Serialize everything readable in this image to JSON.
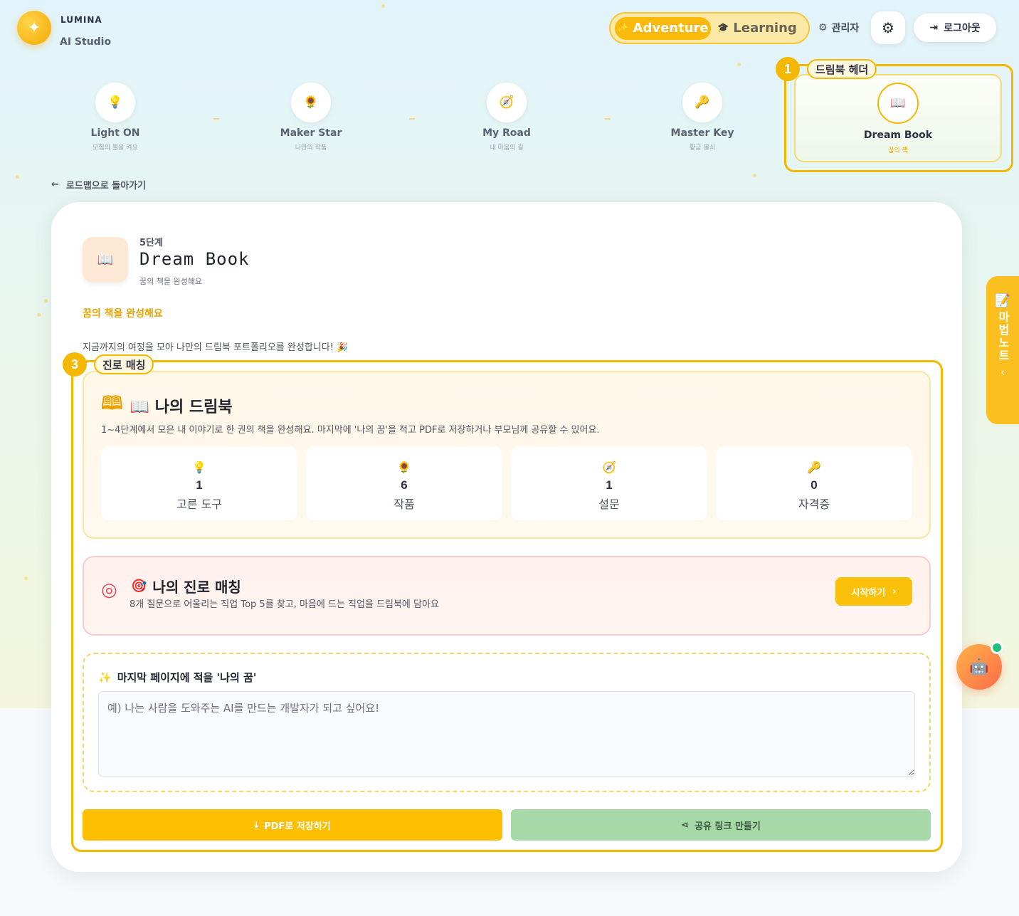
{
  "app": {
    "brand": "LUMINA",
    "brand_sub": "AI Studio"
  },
  "header": {
    "modes": [
      {
        "label": "Adventure",
        "active": true
      },
      {
        "label": "Learning",
        "active": false
      }
    ],
    "admin_label": "관리자",
    "logout_label": "로그아웃"
  },
  "roadmap": {
    "stages": [
      {
        "name": "Light ON",
        "sub": "모험의 불을 켜요",
        "icon": "lightbulb-icon"
      },
      {
        "name": "Maker Star",
        "sub": "나만의 작품",
        "icon": "sunflower-icon"
      },
      {
        "name": "My Road",
        "sub": "내 마음의 길",
        "icon": "compass-icon"
      },
      {
        "name": "Master Key",
        "sub": "황금 열쇠",
        "icon": "key-icon"
      },
      {
        "name": "Dream Book",
        "sub": "꿈의 책",
        "icon": "book-icon",
        "active": true
      }
    ]
  },
  "annotations": [
    {
      "num": "1",
      "label": "드림북 헤더"
    },
    {
      "num": "3",
      "label": "진로 매칭"
    }
  ],
  "back_label": "로드맵으로 돌아가기",
  "stage_header": {
    "step": "5단계",
    "title": "Dream Book",
    "subtitle": "꿈의 책을 완성해요",
    "highlight": "꿈의 책을 완성해요",
    "intro": "지금까지의 여정을 모아 나만의 드림북 포트폴리오를 완성합니다! 🎉"
  },
  "dreambook": {
    "title": "📖 나의 드림북",
    "desc": "1~4단계에서 모은 내 이야기로 한 권의 책을 완성해요. 마지막에 '나의 꿈'을 적고 PDF로 저장하거나 부모님께 공유할 수 있어요.",
    "stats": [
      {
        "icon": "lightbulb-icon",
        "value": "1",
        "label": "고른 도구"
      },
      {
        "icon": "sunflower-icon",
        "value": "6",
        "label": "작품"
      },
      {
        "icon": "compass-icon",
        "value": "1",
        "label": "설문"
      },
      {
        "icon": "key-icon",
        "value": "0",
        "label": "자격증"
      }
    ]
  },
  "career": {
    "title": "나의 진로 매칭",
    "desc": "8개 질문으로 어울리는 직업 Top 5를 찾고, 마음에 드는 직업을 드림북에 담아요",
    "start_label": "시작하기"
  },
  "dream": {
    "label": "마지막 페이지에 적을 '나의 꿈'",
    "placeholder": "예) 나는 사람을 도와주는 AI를 만드는 개발자가 되고 싶어요!"
  },
  "actions": {
    "pdf_label": "PDF로 저장하기",
    "share_label": "공유 링크 만들기"
  },
  "side_tab": {
    "label": "마법노트"
  },
  "colors": {
    "accent": "#f5b800",
    "share": "#a6d8a8",
    "career_icon": "#e0465a"
  }
}
